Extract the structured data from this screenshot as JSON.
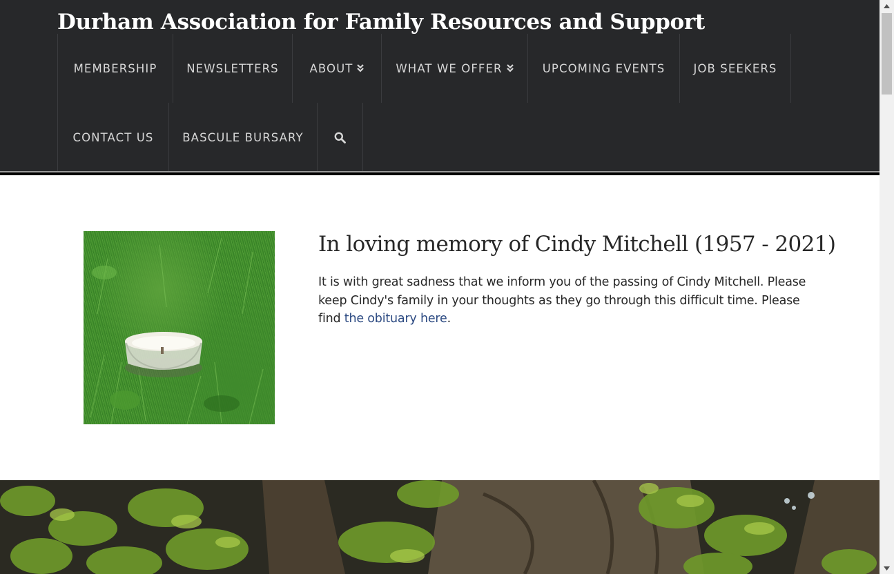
{
  "site": {
    "title": "Durham Association for Family Resources and Support"
  },
  "nav": {
    "row1": [
      {
        "label": "MEMBERSHIP",
        "dropdown": false
      },
      {
        "label": "NEWSLETTERS",
        "dropdown": false
      },
      {
        "label": "ABOUT",
        "dropdown": true
      },
      {
        "label": "WHAT WE OFFER",
        "dropdown": true
      },
      {
        "label": "UPCOMING EVENTS",
        "dropdown": false
      },
      {
        "label": "JOB SEEKERS",
        "dropdown": false
      }
    ],
    "row2": [
      {
        "label": "CONTACT US",
        "dropdown": false
      },
      {
        "label": "BASCULE BURSARY",
        "dropdown": false
      }
    ],
    "search_icon": "search-icon"
  },
  "memorial": {
    "title": "In loving memory of Cindy Mitchell (1957 - 2021)",
    "text_before_link": "It is with great sadness that we inform you of the passing of Cindy Mitchell. Please keep Cindy's family in your thoughts as they go through this difficult time. Please find ",
    "link_text": "the obituary here",
    "text_after_link": "."
  },
  "colors": {
    "header_bg": "#27282a",
    "nav_text": "#d7d7d7",
    "link": "#2c4a82",
    "body_text": "#272727"
  }
}
